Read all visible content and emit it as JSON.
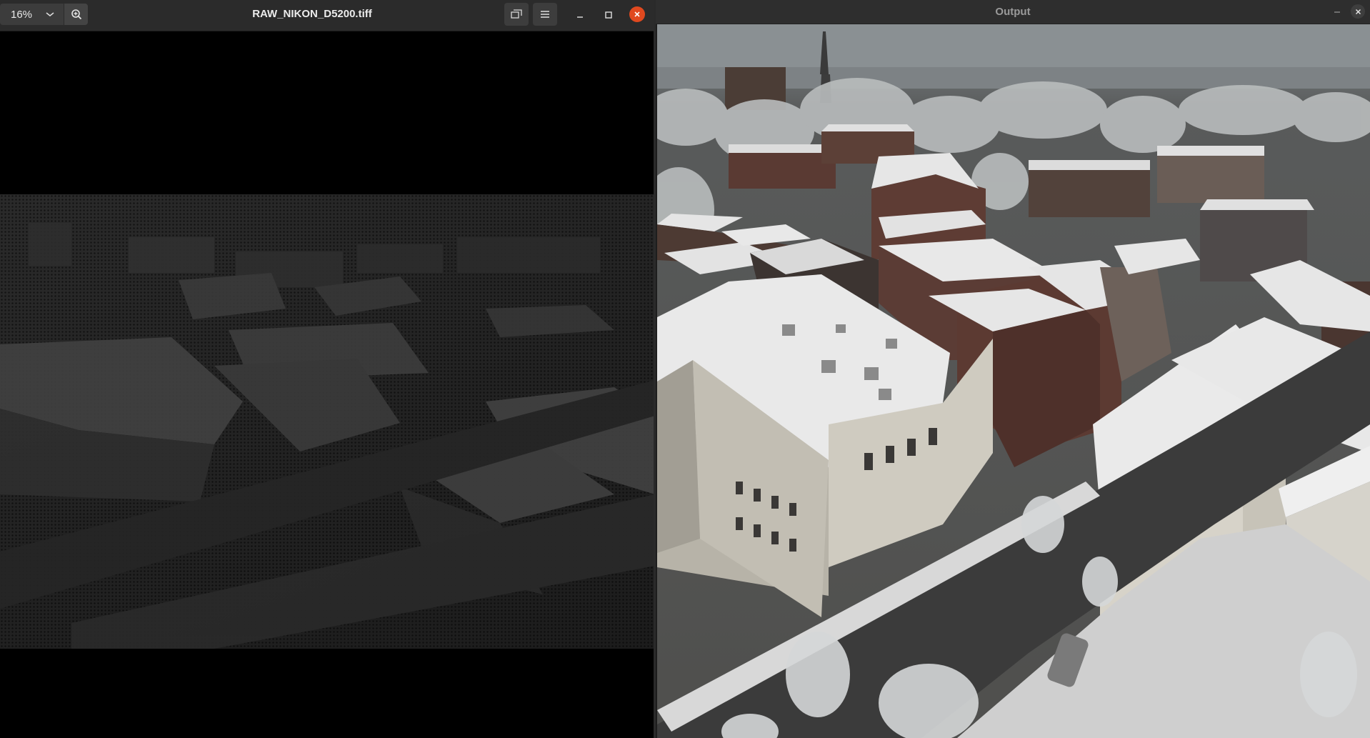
{
  "viewer": {
    "zoom_value": "16%",
    "title": "RAW_NIKON_D5200.tiff",
    "icons": [
      "chevron-down-icon",
      "zoom-in-icon",
      "gallery-icon",
      "hamburger-menu-icon",
      "minimize-icon",
      "maximize-icon",
      "close-icon"
    ]
  },
  "output": {
    "title": "Output",
    "icons": [
      "minimize-icon",
      "close-icon"
    ]
  },
  "colors": {
    "titlebar": "#2b2b2b",
    "close_button": "#e0491f",
    "snow": "#e9e9e9",
    "brick": "#5a3a33"
  }
}
